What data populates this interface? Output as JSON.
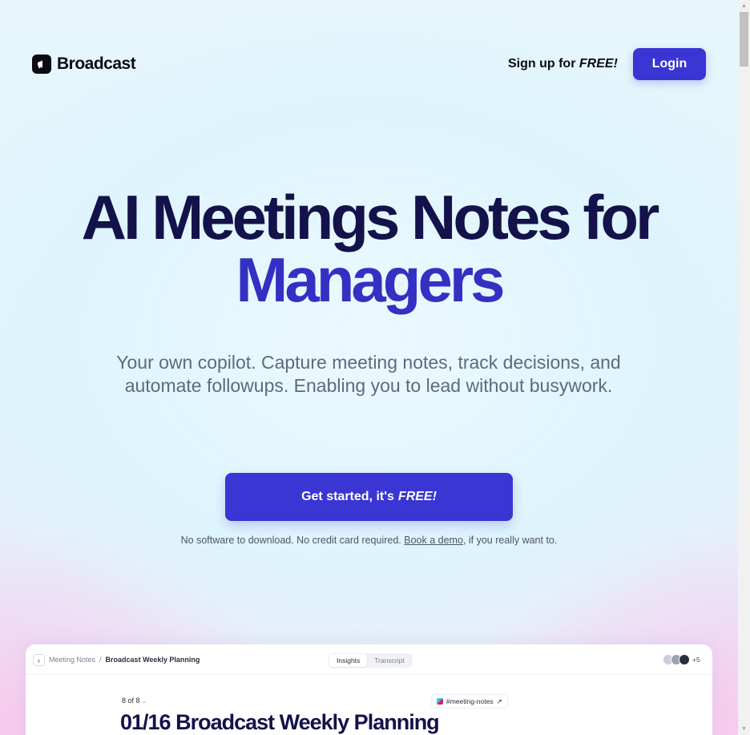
{
  "header": {
    "brand": "Broadcast",
    "signup_text": "Sign up for",
    "signup_emph": "FREE!",
    "login_label": "Login"
  },
  "hero": {
    "title_line1": "AI Meetings Notes for",
    "title_line2": "Managers",
    "subtitle": "Your own copilot. Capture meeting notes, track decisions, and automate followups. Enabling you to lead without busywork.",
    "cta_text": "Get started, it's",
    "cta_emph": "FREE!",
    "note_before": "No software to download. No credit card required.",
    "note_link": "Book a demo",
    "note_after": ", if you really want to."
  },
  "preview": {
    "breadcrumb_parent": "Meeting Notes",
    "breadcrumb_sep": "/",
    "breadcrumb_current": "Broadcast Weekly Planning",
    "tabs": [
      "Insights",
      "Transcript"
    ],
    "active_tab": "Insights",
    "avatars_more": "+5",
    "page_count": "8 of 8",
    "channel": "#meeting-notes",
    "channel_arrow": "↗",
    "title": "01/16 Broadcast Weekly Planning"
  },
  "colors": {
    "accent": "#3a36d3",
    "title_dark": "#13124a",
    "title_accent": "#3330c4"
  },
  "icons": {
    "logo": "megaphone-icon",
    "back": "chevron-left-icon",
    "channel": "slack-icon",
    "scroll_up": "triangle-up-icon",
    "scroll_down": "triangle-down-icon"
  }
}
